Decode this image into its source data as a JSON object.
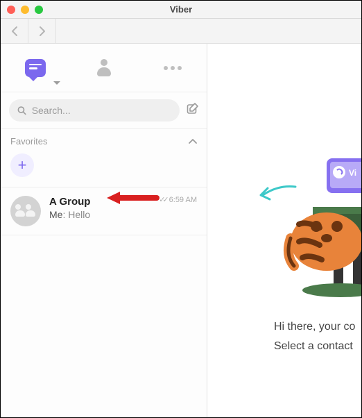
{
  "window": {
    "title": "Viber"
  },
  "search": {
    "placeholder": "Search..."
  },
  "favorites": {
    "label": "Favorites"
  },
  "chats": [
    {
      "name": "A Group",
      "sender": "Me",
      "separator": ": ",
      "preview": "Hello",
      "time": "6:59 AM"
    }
  ],
  "welcome": {
    "line1": "Hi there, your co",
    "line2": "Select a contact"
  }
}
